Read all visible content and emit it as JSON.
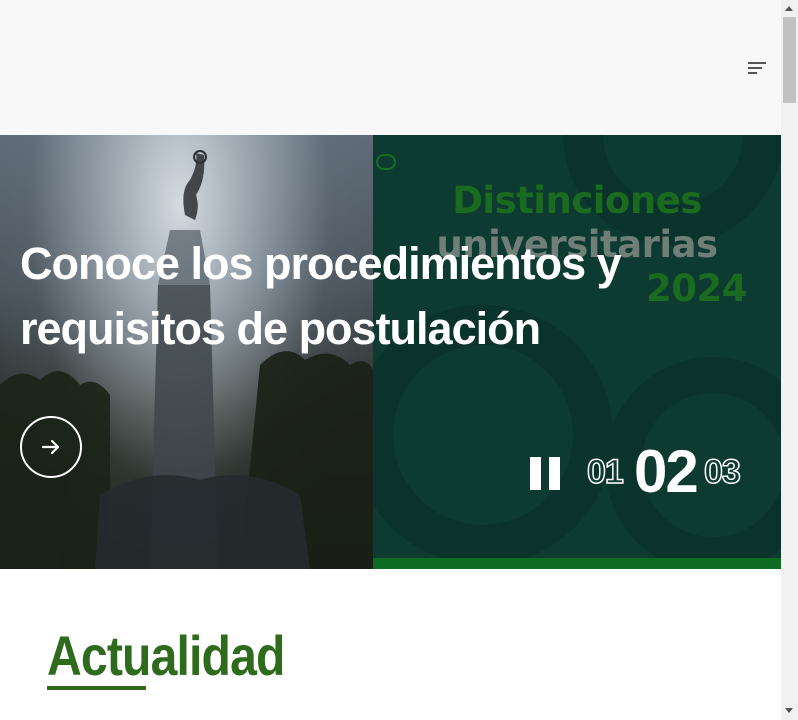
{
  "header": {
    "menu_icon": "hamburger-menu-icon"
  },
  "hero": {
    "headline": "Conoce los procedimientos y requisitos de postulación",
    "next_icon": "arrow-right-icon",
    "poster": {
      "line1": "Distinciones",
      "line2": "universitarias",
      "line3": "2024"
    },
    "controls": {
      "pause_icon": "pause-icon",
      "slides": [
        "01",
        "02",
        "03"
      ],
      "active_slide": "02"
    },
    "colors": {
      "poster_bg": "#0d3a31",
      "poster_green": "#1a6b1f",
      "accent_bar": "#0e6b22"
    }
  },
  "section": {
    "title": "Actualidad",
    "color": "#2e6b1c"
  }
}
